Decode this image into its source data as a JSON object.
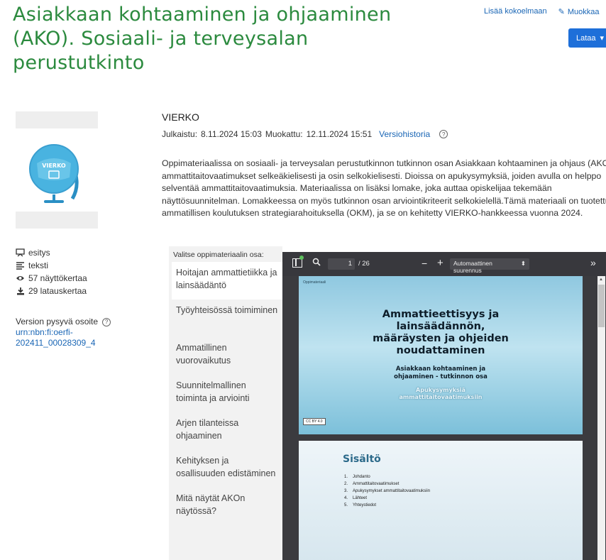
{
  "title": "Asiakkaan kohtaaminen ja ohjaaminen (AKO). Sosiaali- ja terveysalan perustutkinto",
  "actions": {
    "add_collection": "Lisää kokoelmaan",
    "edit": "Muokkaa",
    "download": "Lataa"
  },
  "sidebar": {
    "stats": [
      {
        "icon": "presentation-icon",
        "label": "esitys"
      },
      {
        "icon": "text-lines-icon",
        "label": "teksti"
      },
      {
        "icon": "eye-icon",
        "label": "57 näyttökertaa"
      },
      {
        "icon": "download-icon",
        "label": "29 latauskertaa"
      }
    ],
    "persistent_label": "Version pysyvä osoite",
    "persistent_link": "urn:nbn:fi:oerfi-202411_00028309_4",
    "logo_text": "VIERKO"
  },
  "main": {
    "author": "VIERKO",
    "published_label": "Julkaistu:",
    "published": "8.11.2024 15:03",
    "modified_label": "Muokattu:",
    "modified": "12.11.2024 15:51",
    "version_history": "Versiohistoria",
    "description": "Oppimateriaalissa on sosiaali- ja terveysalan perustutkinnon tutkinnon osan Asiakkaan kohtaaminen ja ohjaus (AKO) ammattitaitovaatimukset selkeäkielisesti ja osin selkokielisesti. Dioissa on apukysymyksiä, joiden avulla on helppo selventää ammattitaitovaatimuksia. Materiaalissa on lisäksi lomake, joka auttaa opiskelijaa tekemään näyttösuunnitelman. Lomakkeessa on myös tutkinnon osan arviointikriteerit selkokielellä.Tämä materiaali on tuotettu ammatillisen koulutuksen strategiarahoituksella (OKM), ja se on kehitetty VIERKO-hankkeessa vuonna 2024."
  },
  "chooser": {
    "header": "Valitse oppimateriaalin osa:",
    "items": [
      "Hoitajan ammattietiikka ja lainsäädäntö",
      "Työyhteisössä toimiminen",
      "Ammatillinen vuorovaikutus",
      "Suunnitelmallinen toiminta ja arviointi",
      "Arjen tilanteissa ohjaaminen",
      "Kehityksen ja osallisuuden edistäminen",
      "Mitä näytät AKOn näytössä?"
    ],
    "active_index": 0
  },
  "viewer": {
    "page": "1",
    "total": "/ 26",
    "zoom": "Automaattinen suurennus",
    "slide1": {
      "label": "Oppimateriaali",
      "title": "Ammattieettisyys ja lainsäädännön, määräysten ja ohjeiden noudattaminen",
      "subtitle": "Asiakkaan kohtaaminen ja ohjaaminen - tutkinnon osa",
      "sub2": "Apukysymyksiä ammattitaitovaatimuksiin",
      "license": "CC BY 4.0"
    },
    "slide2": {
      "title": "Sisältö",
      "items": [
        "Johdanto",
        "Ammattitaitovaatimukset",
        "Apukysymykset ammattitaitovaatimuksiin",
        "Lähteet",
        "Yhteystiedot"
      ]
    }
  }
}
